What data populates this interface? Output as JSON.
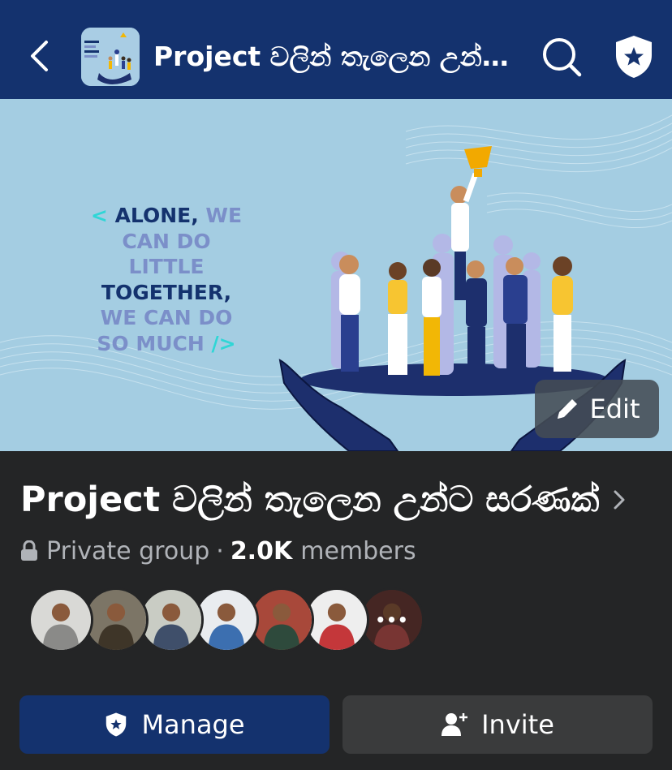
{
  "header": {
    "title": "Project වලින් තැලෙන උන්ට ස...",
    "back_icon": "chevron-left-icon",
    "search_icon": "search-icon",
    "admin_icon": "shield-star-icon"
  },
  "cover": {
    "quote_lines": [
      {
        "parts": [
          {
            "text": "< ",
            "tone": "cyan"
          },
          {
            "text": "ALONE, ",
            "tone": "dark"
          },
          {
            "text": "WE",
            "tone": "light"
          }
        ]
      },
      {
        "parts": [
          {
            "text": "CAN DO",
            "tone": "light"
          }
        ]
      },
      {
        "parts": [
          {
            "text": "LITTLE",
            "tone": "light"
          }
        ]
      },
      {
        "parts": [
          {
            "text": "TOGETHER,",
            "tone": "dark"
          }
        ]
      },
      {
        "parts": [
          {
            "text": "WE CAN DO",
            "tone": "light"
          }
        ]
      },
      {
        "parts": [
          {
            "text": "SO MUCH ",
            "tone": "light"
          },
          {
            "text": "/>",
            "tone": "cyan"
          }
        ]
      }
    ],
    "edit_label": "Edit"
  },
  "group": {
    "name": "Project වලින් තැලෙන උන්ට සරණක්",
    "privacy": "Private group",
    "separator": "·",
    "member_count": "2.0K",
    "members_label": "members"
  },
  "avatars": [
    {
      "bg": "#d9d9d6",
      "fg": "#8a8a88"
    },
    {
      "bg": "#7c7566",
      "fg": "#3e3528"
    },
    {
      "bg": "#c9ccc4",
      "fg": "#3f4f6a"
    },
    {
      "bg": "#e9ecef",
      "fg": "#3c6fb0"
    },
    {
      "bg": "#a8483a",
      "fg": "#2e4a3c"
    },
    {
      "bg": "#eeeeee",
      "fg": "#c4373a"
    },
    {
      "bg": "#6b3b36",
      "fg": "#b9524f",
      "more": "•••"
    }
  ],
  "actions": {
    "manage_label": "Manage",
    "invite_label": "Invite"
  },
  "colors": {
    "header_bg": "#14326e",
    "page_bg": "#242526",
    "manage_bg": "#14326e",
    "invite_bg": "#3a3b3c"
  }
}
